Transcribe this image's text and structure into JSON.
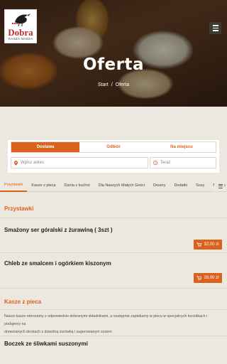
{
  "brand": {
    "name": "Dobra",
    "tagline": "KASZA NASZA"
  },
  "colors": {
    "accent": "#d9621e",
    "background": "#ece7df"
  },
  "header": {
    "menu_icon": "hamburger-icon"
  },
  "hero": {
    "title": "Oferta",
    "breadcrumbs": [
      "Start",
      "/",
      "Oferta"
    ]
  },
  "order": {
    "modes": [
      "Dostawa",
      "Odbiór",
      "Na miejscu"
    ],
    "active_mode": "Dostawa",
    "address_placeholder": "Wpisz adres",
    "time_placeholder": "Teraz"
  },
  "categories": [
    "Przystawki",
    "Kasze z pieca",
    "Dania z kuchni",
    "Dla Naszych Małych Gości",
    "Desery",
    "Dodatki",
    "Sosy",
    "Napoje"
  ],
  "menu": {
    "sections": [
      {
        "title": "Przystawki",
        "items": [
          {
            "name": "Smażony ser góralski z żurawiną ( 3szt )",
            "price": "32,00 zł"
          },
          {
            "name": "Chleb ze smalcem i ogórkiem kiszonym",
            "price": "28,00 zł"
          }
        ]
      },
      {
        "title": "Kasze z pieca",
        "description_lines": [
          "Nasze kasze mieszamy z odpowiednio dobranymi składnikami, a następnie zapiekamy w piecu w specjalnych kociołkach i podajemy na",
          "drewnianych deskach z dowolną surówką i sugerowanym sosem"
        ],
        "items": [
          {
            "name": "Boczek ze śliwkami suszonymi"
          }
        ]
      }
    ]
  }
}
